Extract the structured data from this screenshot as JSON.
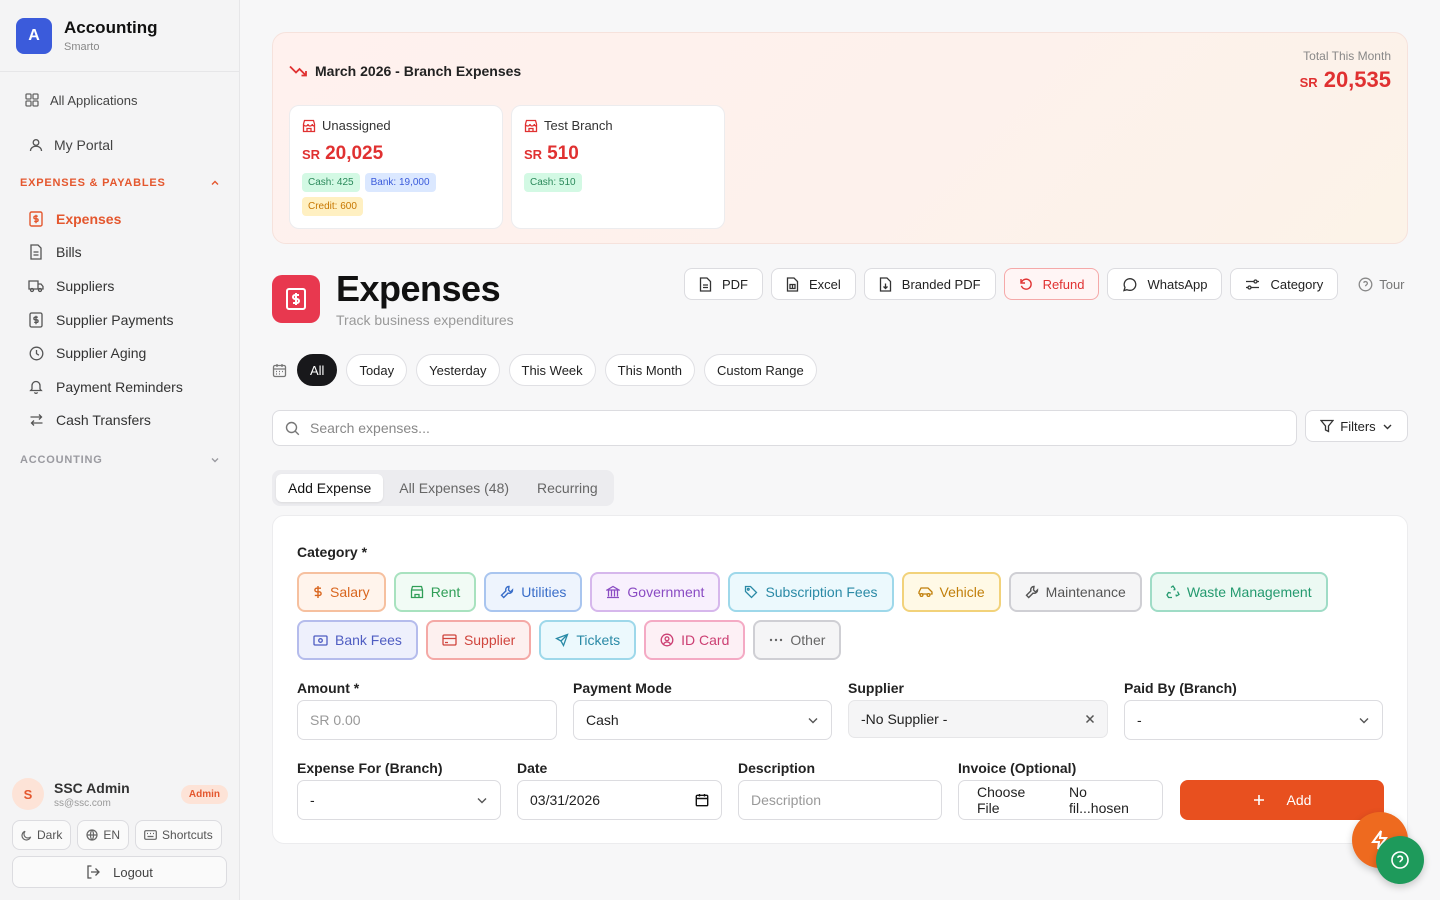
{
  "app": {
    "logo_letter": "A",
    "title": "Accounting",
    "subtitle": "Smarto"
  },
  "sidebar": {
    "all_apps": "All Applications",
    "portal": "My Portal",
    "section_expenses": "EXPENSES & PAYABLES",
    "section_accounting": "ACCOUNTING",
    "items": [
      {
        "label": "Expenses",
        "icon": "dollar-doc-icon",
        "active": true
      },
      {
        "label": "Bills",
        "icon": "doc-icon"
      },
      {
        "label": "Suppliers",
        "icon": "truck-icon"
      },
      {
        "label": "Supplier Payments",
        "icon": "dollar-doc-icon"
      },
      {
        "label": "Supplier Aging",
        "icon": "clock-icon"
      },
      {
        "label": "Payment Reminders",
        "icon": "bell-icon"
      },
      {
        "label": "Cash Transfers",
        "icon": "arrows-icon"
      }
    ],
    "user": {
      "initial": "S",
      "name": "SSC Admin",
      "email": "ss@ssc.com",
      "role": "Admin"
    },
    "theme": "Dark",
    "language": "EN",
    "shortcuts": "Shortcuts",
    "logout": "Logout"
  },
  "summary": {
    "title": "March 2026 - Branch Expenses",
    "total_label": "Total This Month",
    "currency": "SR",
    "total": "20,535",
    "branches": [
      {
        "name": "Unassigned",
        "amount": "20,025",
        "cash": "Cash: 425",
        "bank": "Bank: 19,000",
        "credit": "Credit: 600"
      },
      {
        "name": "Test Branch",
        "amount": "510",
        "cash": "Cash: 510"
      }
    ]
  },
  "header": {
    "title": "Expenses",
    "subtitle": "Track business expenditures",
    "actions": {
      "pdf": "PDF",
      "excel": "Excel",
      "branded_pdf": "Branded PDF",
      "refund": "Refund",
      "whatsapp": "WhatsApp",
      "category": "Category",
      "tour": "Tour"
    }
  },
  "date_filters": [
    "All",
    "Today",
    "Yesterday",
    "This Week",
    "This Month",
    "Custom Range"
  ],
  "search": {
    "placeholder": "Search expenses...",
    "filters": "Filters"
  },
  "tabs": [
    "Add Expense",
    "All Expenses (48)",
    "Recurring"
  ],
  "form": {
    "category_label": "Category *",
    "categories": [
      "Salary",
      "Rent",
      "Utilities",
      "Government",
      "Subscription Fees",
      "Vehicle",
      "Maintenance",
      "Waste Management",
      "Bank Fees",
      "Supplier",
      "Tickets",
      "ID Card",
      "Other"
    ],
    "amount_label": "Amount *",
    "amount_placeholder": "SR 0.00",
    "payment_mode_label": "Payment Mode",
    "payment_mode_value": "Cash",
    "supplier_label": "Supplier",
    "supplier_value": "-No Supplier -",
    "paid_by_label": "Paid By (Branch)",
    "paid_by_value": "-",
    "expense_for_label": "Expense For (Branch)",
    "expense_for_value": "-",
    "date_label": "Date",
    "date_value": "03/31/2026",
    "description_label": "Description",
    "description_placeholder": "Description",
    "invoice_label": "Invoice (Optional)",
    "invoice_button": "Choose File",
    "invoice_status": "No fil...hosen",
    "add_button": "Add"
  }
}
